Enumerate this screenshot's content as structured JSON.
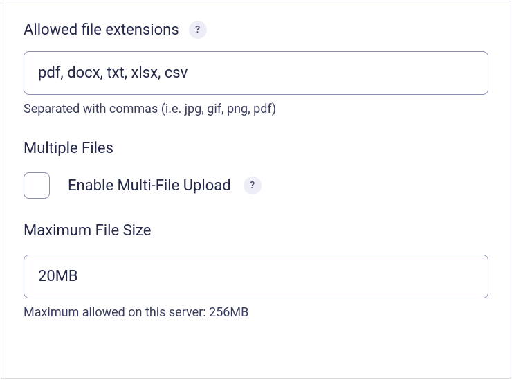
{
  "allowedExtensions": {
    "label": "Allowed file extensions",
    "value": "pdf, docx, txt, xlsx, csv",
    "hint": "Separated with commas (i.e. jpg, gif, png, pdf)",
    "help": "?"
  },
  "multipleFiles": {
    "heading": "Multiple Files",
    "checkboxLabel": "Enable Multi-File Upload",
    "help": "?"
  },
  "maxFileSize": {
    "heading": "Maximum File Size",
    "value": "20MB",
    "hint": "Maximum allowed on this server: 256MB"
  }
}
